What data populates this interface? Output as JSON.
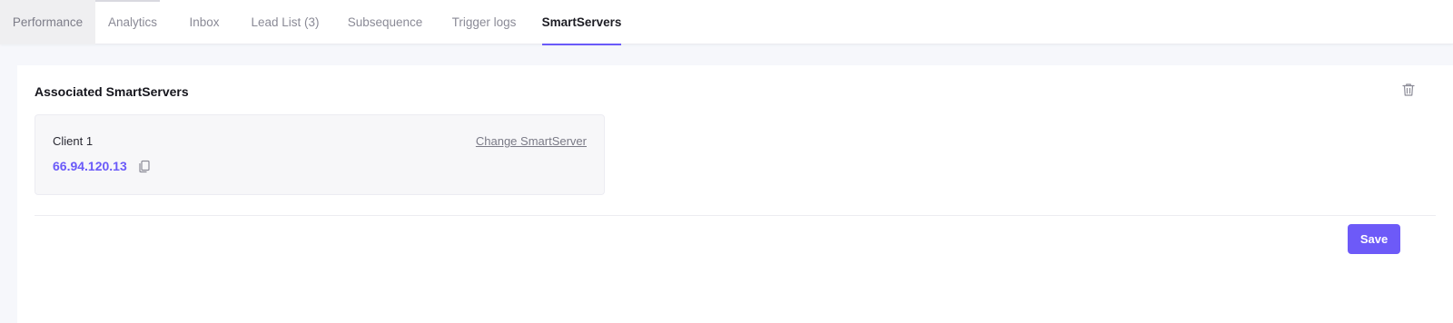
{
  "tabs": [
    {
      "label": "Performance",
      "active": false
    },
    {
      "label": "Analytics",
      "active": false
    },
    {
      "label": "Inbox",
      "active": false
    },
    {
      "label": "Lead List (3)",
      "active": false
    },
    {
      "label": "Subsequence",
      "active": false
    },
    {
      "label": "Trigger logs",
      "active": false
    },
    {
      "label": "SmartServers",
      "active": true
    }
  ],
  "section": {
    "title": "Associated SmartServers"
  },
  "server": {
    "client_name": "Client 1",
    "change_label": "Change SmartServer",
    "ip": "66.94.120.13"
  },
  "actions": {
    "save_label": "Save"
  },
  "colors": {
    "accent": "#6a5af9",
    "save_button": "#6d5af8"
  },
  "icons": {
    "delete": "trash-icon",
    "copy": "copy-icon"
  }
}
